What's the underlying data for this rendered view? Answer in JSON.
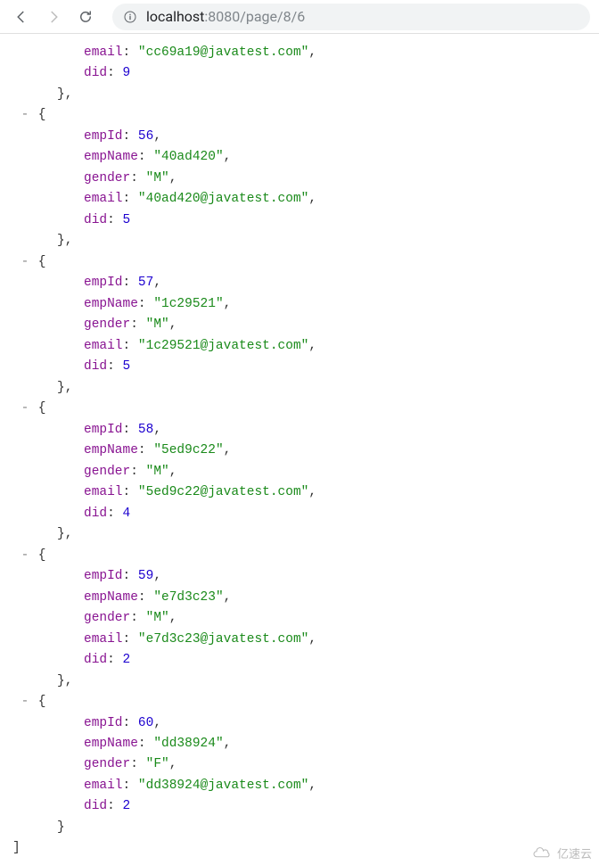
{
  "browser": {
    "url_host": "localhost",
    "url_port_path": ":8080/page/8/6"
  },
  "json_keys": {
    "empId": "empId",
    "empName": "empName",
    "gender": "gender",
    "email": "email",
    "did": "did"
  },
  "records": [
    {
      "partial": true,
      "email": "cc69a19@javatest.com",
      "did": 9
    },
    {
      "empId": 56,
      "empName": "40ad420",
      "gender": "M",
      "email": "40ad420@javatest.com",
      "did": 5
    },
    {
      "empId": 57,
      "empName": "1c29521",
      "gender": "M",
      "email": "1c29521@javatest.com",
      "did": 5
    },
    {
      "empId": 58,
      "empName": "5ed9c22",
      "gender": "M",
      "email": "5ed9c22@javatest.com",
      "did": 4
    },
    {
      "empId": 59,
      "empName": "e7d3c23",
      "gender": "M",
      "email": "e7d3c23@javatest.com",
      "did": 2
    },
    {
      "empId": 60,
      "empName": "dd38924",
      "gender": "F",
      "email": "dd38924@javatest.com",
      "did": 2
    }
  ],
  "watermark": "亿速云"
}
